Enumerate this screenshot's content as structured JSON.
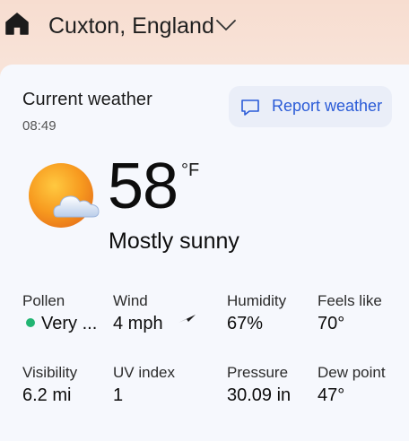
{
  "header": {
    "location": "Cuxton, England",
    "home_icon": "home-icon",
    "dropdown_icon": "chevron-down-icon"
  },
  "current": {
    "title": "Current weather",
    "time": "08:49",
    "report_label": "Report weather",
    "temperature": "58",
    "unit": "°F",
    "condition": "Mostly sunny",
    "condition_icon": "sun-behind-cloud-icon"
  },
  "metrics": [
    {
      "label": "Pollen",
      "value": "Very ...",
      "indicator_color": "#22b573"
    },
    {
      "label": "Wind",
      "value": "4 mph",
      "icon": "wind-direction-arrow-icon"
    },
    {
      "label": "Humidity",
      "value": "67%"
    },
    {
      "label": "Feels like",
      "value": "70°"
    },
    {
      "label": "Visibility",
      "value": "6.2 mi"
    },
    {
      "label": "UV index",
      "value": "1"
    },
    {
      "label": "Pressure",
      "value": "30.09 in"
    },
    {
      "label": "Dew point",
      "value": "47°"
    }
  ],
  "colors": {
    "accent": "#2a5bd7",
    "header_bg": "#f7ddd0",
    "card_bg": "#f6f8fd",
    "pollen_dot": "#22b573"
  }
}
